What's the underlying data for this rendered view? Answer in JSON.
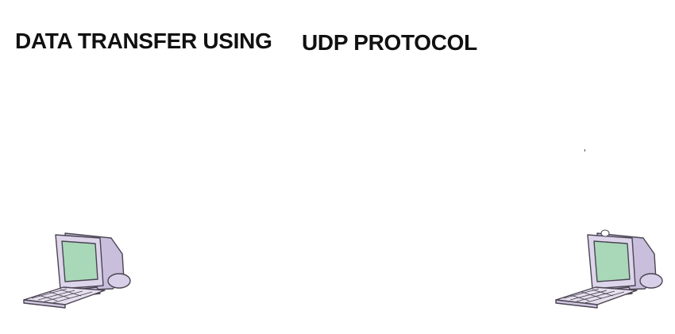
{
  "title": {
    "part1": "DATA TRANSFER USING",
    "part2": "UDP PROTOCOL"
  },
  "nodes": [
    {
      "icon": "computer-icon"
    },
    {
      "icon": "computer-icon"
    }
  ],
  "colors": {
    "monitor_body": "#d8d0e8",
    "monitor_outline": "#4a4452",
    "screen": "#a9d8b8",
    "keyboard": "#e6e0ee"
  }
}
